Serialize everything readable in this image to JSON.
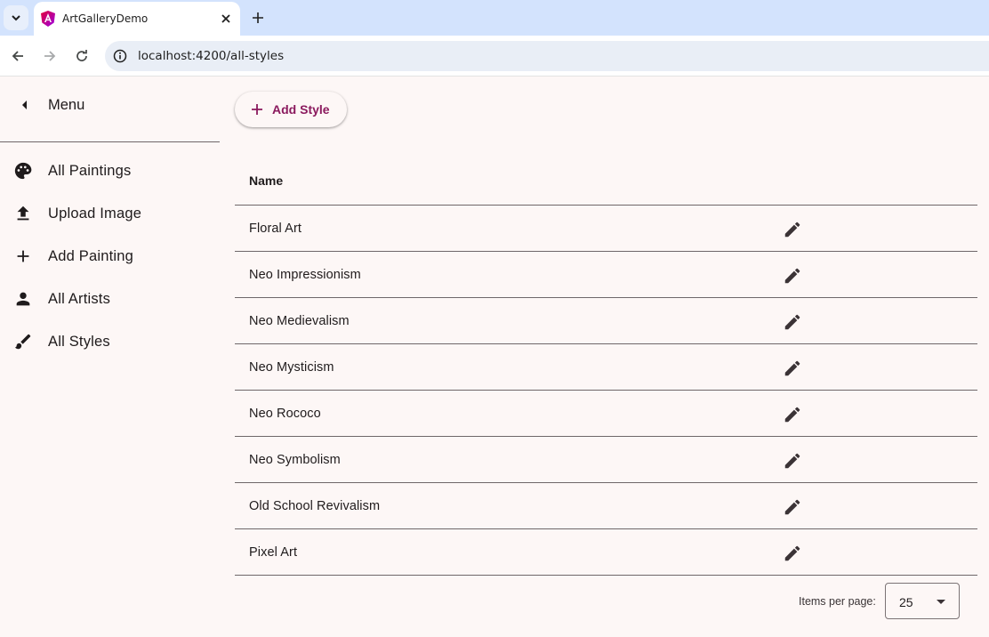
{
  "browser": {
    "tab_title": "ArtGalleryDemo",
    "url": "localhost:4200/all-styles"
  },
  "sidebar": {
    "menu_label": "Menu",
    "items": [
      {
        "label": "All Paintings",
        "icon": "palette-icon"
      },
      {
        "label": "Upload Image",
        "icon": "upload-icon"
      },
      {
        "label": "Add Painting",
        "icon": "plus-icon"
      },
      {
        "label": "All Artists",
        "icon": "person-icon"
      },
      {
        "label": "All Styles",
        "icon": "brush-icon"
      }
    ]
  },
  "main": {
    "add_button_label": "Add Style",
    "table": {
      "header_name": "Name",
      "rows": [
        "Floral Art",
        "Neo Impressionism",
        "Neo Medievalism",
        "Neo Mysticism",
        "Neo Rococo",
        "Neo Symbolism",
        "Old School Revivalism",
        "Pixel Art"
      ]
    },
    "paginator": {
      "items_per_page_label": "Items per page:",
      "page_size": "25"
    }
  },
  "colors": {
    "accent": "#8b1a5e",
    "background": "#fdf7f6",
    "tabstrip": "#d3e3fd"
  }
}
